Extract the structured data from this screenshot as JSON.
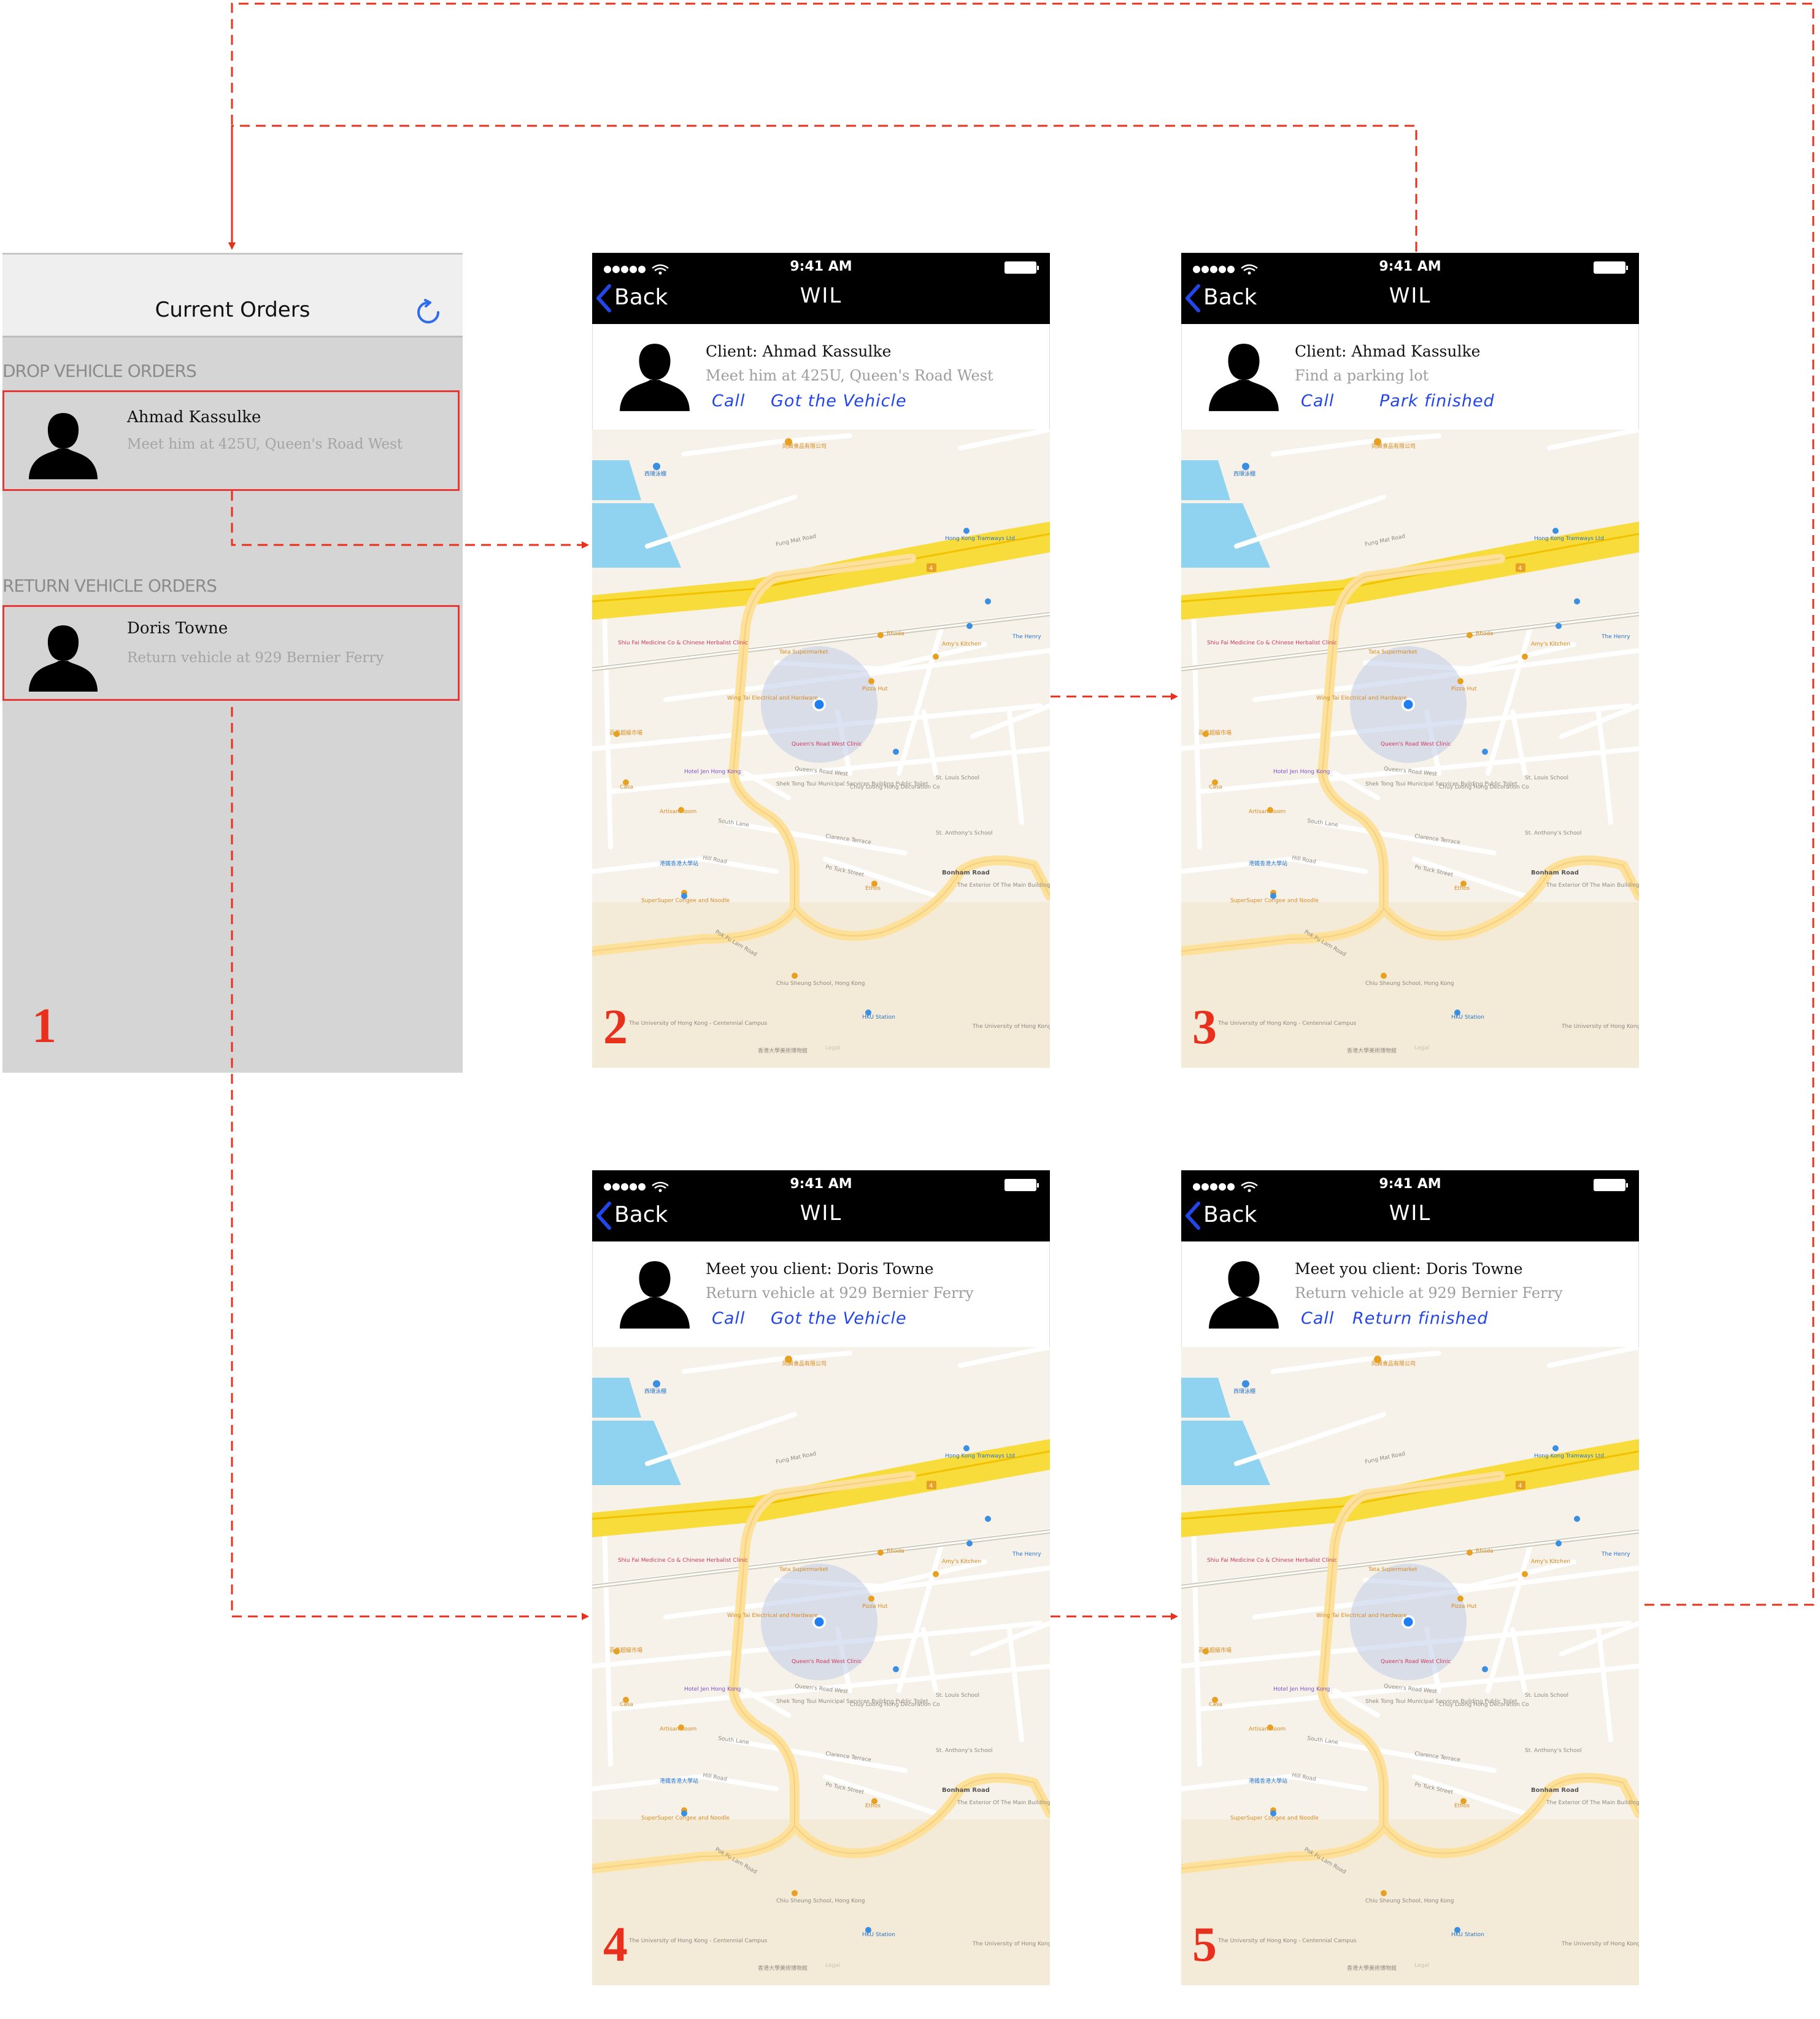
{
  "list_screen": {
    "title": "Current Orders",
    "refresh_icon": "refresh-icon",
    "drop_section": "DROP VEHICLE ORDERS",
    "return_section": "RETURN VEHICLE ORDERS",
    "drop_order": {
      "name": "Ahmad Kassulke",
      "detail": "Meet him at 425U, Queen's Road West"
    },
    "return_order": {
      "name": "Doris Towne",
      "detail": "Return vehicle at 929 Bernier Ferry"
    },
    "step": "1"
  },
  "status": {
    "time": "9:41 AM"
  },
  "nav": {
    "back": "Back",
    "title": "WIL"
  },
  "screens": [
    {
      "step": "2",
      "title": "Client: Ahmad Kassulke",
      "subtitle": "Meet him at 425U, Queen's Road West",
      "action1": "Call",
      "action2": "Got the Vehicle"
    },
    {
      "step": "3",
      "title": "Client: Ahmad Kassulke",
      "subtitle": "Find a parking lot",
      "action1": "Call",
      "action2": "Park finished"
    },
    {
      "step": "4",
      "title": "Meet you client: Doris Towne",
      "subtitle": "Return vehicle at 929 Bernier Ferry",
      "action1": "Call",
      "action2": "Got the Vehicle"
    },
    {
      "step": "5",
      "title": "Meet you client: Doris Towne",
      "subtitle": "Return vehicle at 929 Bernier Ferry",
      "action1": "Call",
      "action2": "Return finished"
    }
  ],
  "map": {
    "labels": {
      "sai_ying_pun_pool": "西環泳棚",
      "tung_hing": "同興食品有限公司",
      "hk_tramways": "Hong Kong Tramways Ltd",
      "fung_mat_road": "Fung Mat Road",
      "route_4": "4",
      "shiu_fai": "Shiu Fai Medicine Co & Chinese Herbalist Clinic",
      "tata": "Tata Supermarket",
      "rhoda": "Rhoda",
      "amys_kitchen": "Amy's Kitchen",
      "the_henry": "The Henry",
      "wing_tai": "Wing Tai Electrical and Hardware",
      "pizza_hut": "Pizza Hut",
      "bak_kei": "百佳超級市場",
      "queens_clinic": "Queen's Road West Clinic",
      "hotel_jen": "Hotel Jen Hong Kong",
      "queens_road_west": "Queen's Road West",
      "casa": "Casa",
      "shek_tong_tsui": "Shek Tong Tsui Municipal Services Building Public Toilet",
      "chuy_loong": "Chuy Loong Hong Decoration Co",
      "st_louis": "St. Louis School",
      "artisan_room": "Artisan Room",
      "south_lane": "South Lane",
      "clarence_terrace": "Clarence Terrace",
      "st_anthonys": "St. Anthony's School",
      "hill_road": "Hill Road",
      "po_tuck_street": "Po Tuck Street",
      "bonham_road": "Bonham Road",
      "hku_univ": "港鐵香港大學站",
      "ethos": "Ethos",
      "exterior_main": "The Exterior Of The Main Building, The University of Hong Kong",
      "superSuper": "SuperSuper Congee and Noodle",
      "pok_fu_lam": "Pok Fu Lam Road",
      "chiu_sheung": "Chiu Sheung School, Hong Kong",
      "hku_station": "HKU Station",
      "hku_centennial": "The University of Hong Kong - Centennial Campus",
      "hku_museum": "香港大學美術博物館",
      "univ_hk": "The University of Hong Kong",
      "legal": "Legal"
    }
  }
}
